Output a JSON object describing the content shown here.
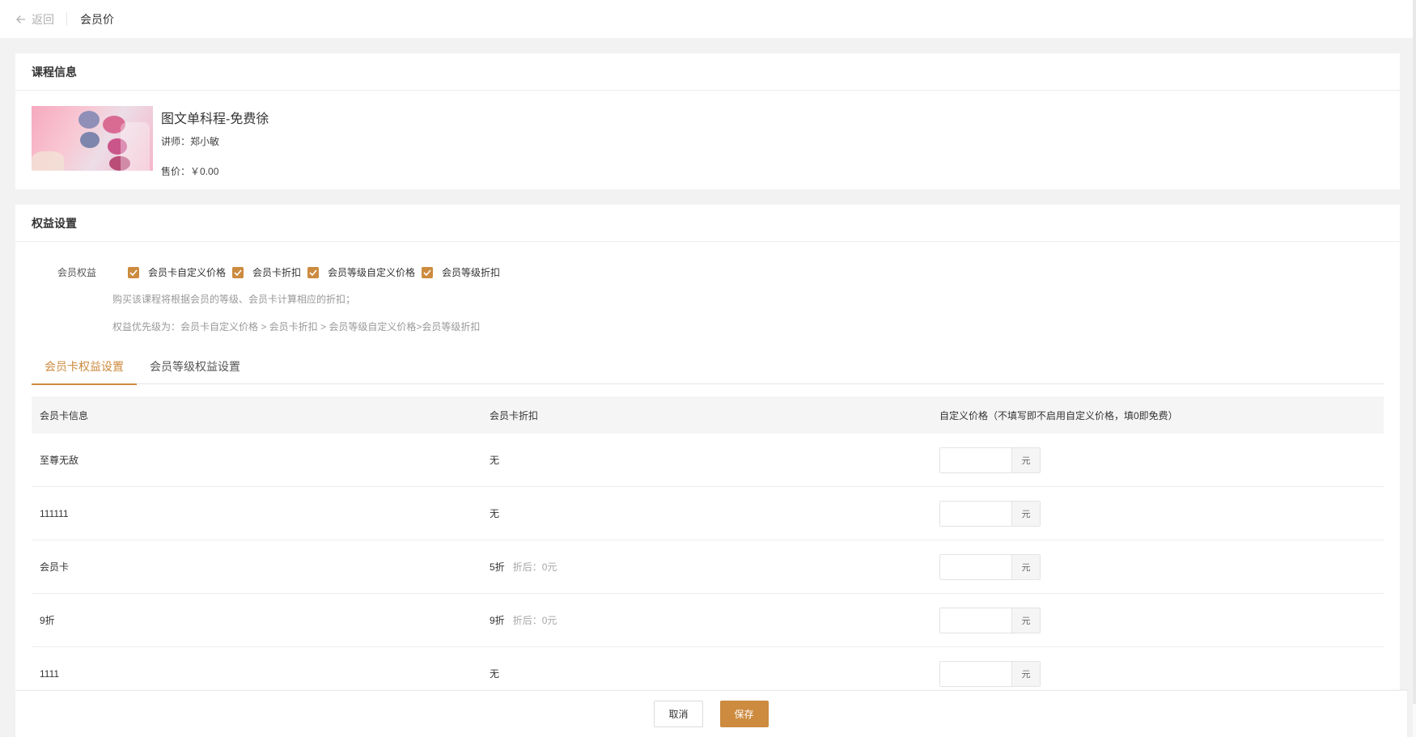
{
  "topbar": {
    "back_label": "返回",
    "title": "会员价"
  },
  "course": {
    "section_title": "课程信息",
    "name": "图文单科程-免费徐",
    "teacher_label": "讲师：",
    "teacher": "郑小敏",
    "price_label": "售价：",
    "price": "￥0.00"
  },
  "rights": {
    "section_title": "权益设置",
    "label": "会员权益",
    "options": [
      {
        "label": "会员卡自定义价格",
        "checked": true
      },
      {
        "label": "会员卡折扣",
        "checked": true
      },
      {
        "label": "会员等级自定义价格",
        "checked": true
      },
      {
        "label": "会员等级折扣",
        "checked": true
      }
    ],
    "hint1": "购买该课程将根据会员的等级、会员卡计算相应的折扣；",
    "hint2": "权益优先级为：会员卡自定义价格 > 会员卡折扣 > 会员等级自定义价格>会员等级折扣"
  },
  "tabs": [
    {
      "label": "会员卡权益设置",
      "active": true
    },
    {
      "label": "会员等级权益设置",
      "active": false
    }
  ],
  "table": {
    "headers": [
      "会员卡信息",
      "会员卡折扣",
      "自定义价格（不填写即不启用自定义价格，填0即免费）"
    ],
    "rows": [
      {
        "name": "至尊无敌",
        "discount": "无",
        "after": "",
        "price": ""
      },
      {
        "name": "111111",
        "discount": "无",
        "after": "",
        "price": ""
      },
      {
        "name": "会员卡",
        "discount": "5折",
        "after": "折后：0元",
        "price": ""
      },
      {
        "name": "9折",
        "discount": "9折",
        "after": "折后：0元",
        "price": ""
      },
      {
        "name": "1111",
        "discount": "无",
        "after": "",
        "price": ""
      }
    ],
    "unit": "元"
  },
  "footer": {
    "cancel": "取消",
    "save": "保存"
  },
  "colors": {
    "accent": "#cc8b3f"
  }
}
